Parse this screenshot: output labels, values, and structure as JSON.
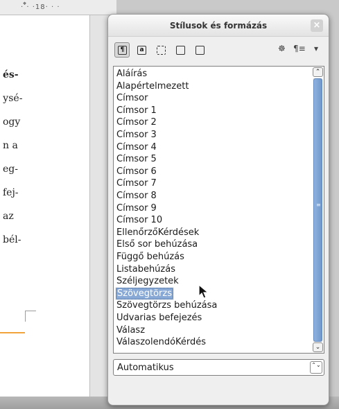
{
  "ruler": {
    "label": "· · ·18· · ·"
  },
  "page": {
    "lines": [
      "és-",
      "уsé-",
      "ogy",
      "n a",
      "eg-",
      "fej-",
      "az",
      "bél-"
    ]
  },
  "panel": {
    "title": "Stílusok és formázás",
    "close_glyph": "×",
    "toolbar": {
      "paragraph_styles": "¶",
      "character_styles": "a",
      "frame_styles": "",
      "page_styles": "",
      "list_styles": "",
      "fill_format": "☸",
      "new_style": "¶≡",
      "menu_arrow": "▾"
    },
    "styles": [
      "Aláírás",
      "Alapértelmezett",
      "Címsor",
      "Címsor 1",
      "Címsor 2",
      "Címsor 3",
      "Címsor 4",
      "Címsor 5",
      "Címsor 6",
      "Címsor 7",
      "Címsor 8",
      "Címsor 9",
      "Címsor 10",
      "EllenőrzőKérdések",
      "Első sor behúzása",
      "Függő behúzás",
      "Listabehúzás",
      "Széljegyzetek",
      "Szövegtörzs",
      "Szövegtörzs behúzása",
      "Udvarias befejezés",
      "Válasz",
      "VálaszolendóKérdés"
    ],
    "selected_style": "Szövegtörzs",
    "scroll": {
      "up": "⌃",
      "down": "⌄",
      "grip": "≡"
    },
    "filter": {
      "value": "Automatikus",
      "arrows": "⌃⌄"
    }
  },
  "colors": {
    "selection": "#88a9d6",
    "scroll_thumb": "#7fa5d7",
    "orange_marker": "#f2a33a"
  }
}
